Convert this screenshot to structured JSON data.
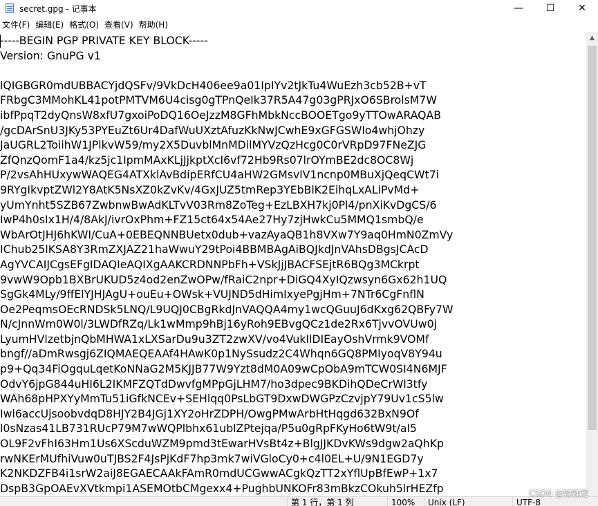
{
  "window": {
    "title": "secret.gpg - 记事本",
    "icon": "notepad-icon",
    "controls": {
      "minimize": "—",
      "maximize": "☐",
      "close": "✕"
    }
  },
  "menu": {
    "items": [
      "文件(F)",
      "编辑(E)",
      "格式(O)",
      "查看(V)",
      "帮助(H)"
    ]
  },
  "editor": {
    "lines": [
      "-----BEGIN PGP PRIVATE KEY BLOCK-----",
      "Version: GnuPG v1",
      "",
      "lQIGBGR0mdUBBACYjdQSFv/9VkDcH406ee9a01IpIYv2tJkTu4WuEzh3cb52B+vT",
      "FRbgC3MMohKL41potPMTVM6U4cisg0gTPnQeIk37R5A47g03gPRJxO6SBrolsM7W",
      "ibfPpqT2dyQnsW8xfU7gxoiPoDQ16OeJzzM8GFhMbkNccBOOETgo9yTTOwARAQAB",
      "/gcDArSnU3JKy53PYEuZt6Ur4DafWuUXztAfuzKkNwJCwhE9xGFGSWlo4whjOhzy",
      "JaUGRL2ToiihW1JPlkvW59/my2X5DuvblMnMDilMYVzQzHcg0C0rVRpD97FNeZJG",
      "ZfQnzQomF1a4/kz5jc1IpmMAxKLjJjkptXcI6vf72Hb9Rs07lrOYmBE2dc8OC8Wj",
      "P/2vsAhHUxywWAQEG4ATXklAvBdipERfCU4aHW2GMsvlV1ncnp0MBuXjQeqCWt7i",
      "9RYgIkvptZWl2Y8AtK5NsXZ0kZvKv/4GxJUZ5tmRep3YEbBlK2EihqLxALiPvMd+",
      "yUmYnht5SZB67ZwbnwBwAdKLTvV03Rm8ZoTeg+EzLBXH7kj0Pl4/pnXiKvDgCS/6",
      "IwP4h0sIx1H/4/8AkJ/ivrOxPhm+FZ15ct64x54Ae27Hy7zjHwkCu5MMQ1smbQ/e",
      "WbArOtJHJ6hKWI/CuA+0EBEQNNBUetx0dub+vazAyaQB1h8VXw7Y9aq0HmN0ZmVy",
      "IChub25lKSA8Y3RmZXJAZ21haWwuY29tPoi4BBMBAgAiBQJkdJnVAhsDBgsJCAcD",
      "AgYVCAIJCgsEFgIDAQIeAQIXgAAKCRDNNPbFh+VSkJjJBACFSEjtR6BQg3MCkrpt",
      "9vwW9Opb1BXBrUKUD5z4od2enZwOPw/fRaiC2npr+DiGQ4XyIQzwsyn6Gx62h1UQ",
      "SgGk4MLy/9ffElYJHJAgU+ouEu+OWsk+VUJND5dHimIxyePgjHm+7NTr6CgFnflN",
      "Oe2PeqmsOEcRNDSk5LNQ/L9UQJ0CBgRkdJnVAQQA4my1wcQGuuJ6dKxg62QBFy7W",
      "N/cJnnWm0W0l/3LWDfRZq/Lk1wMmp9hBj16yRoh9EBvgQCz1de2Rx6TjvvOVUw0j",
      "LyumHVlzetbjnQbMHWA1xLXSarDu9u3ZT2zwXV/vo4VukIlDIEayOshVrmk9VOMf",
      "bngf//aDmRwsgj6ZIQMAEQEAAf4HAwK0p1NySsudz2C4Whqn6GQ8PMIyoqV8Y94u",
      "p9+Qq34FiOgquLqetKoNNaG2M5KJJB77W9Yzt8dM0A09wCpObA9mTCW0SI4N6MJF",
      "OdvY6jpG844uHI6L2IKMFZQTdDwvfgMPpGjLHM7/ho3dpec9BKDihQDeCrWl3tfy",
      "WAh68pHPXYyMmTu51iGfkNCEv+SEHlqq0PsLbGT9DxwDWGPzCzvjpY79Uv1cS5lw",
      "Iwl6accUjsoobvdqD8HJY2B4JGj1XY2oHrZDPH/OwgPMwArbHtHqgd632BxN9Of",
      "l0sNzas41LB731RUcP79M7wWQPlbhx61ublZPtejqa/P5u0gRpFKyHo6tW9t/al5",
      "OL9F2vFhI63Hm1Us6XScduWZM9pmd3tEwarHVsBt4z+BlgJJKDvKWs9dgw2aQhKp",
      "rwNKErMUfhiVuw0uTJBS2F4JsPjKdF7hp3mk7wiVGloCy0+c4l0EL+U/9N1EGD7y",
      "K2NKDZFB4i1srW2aiJ8EGAECAAkFAmR0mdUCGwwACgkQzTT2xYflUpBfEwP+1x7",
      "DspB3GpOAEvXVtkmpi1ASEMOtbCMgexx4+PughbUNKOFr83mBkzCOkuh5lrHEZfp"
    ]
  },
  "statusbar": {
    "position": "第 1 行，第 1 列",
    "zoom": "100%",
    "line_ending": "Unix (LF)",
    "encoding": "UTF-8"
  },
  "watermark": "CSDN @辣辣党"
}
